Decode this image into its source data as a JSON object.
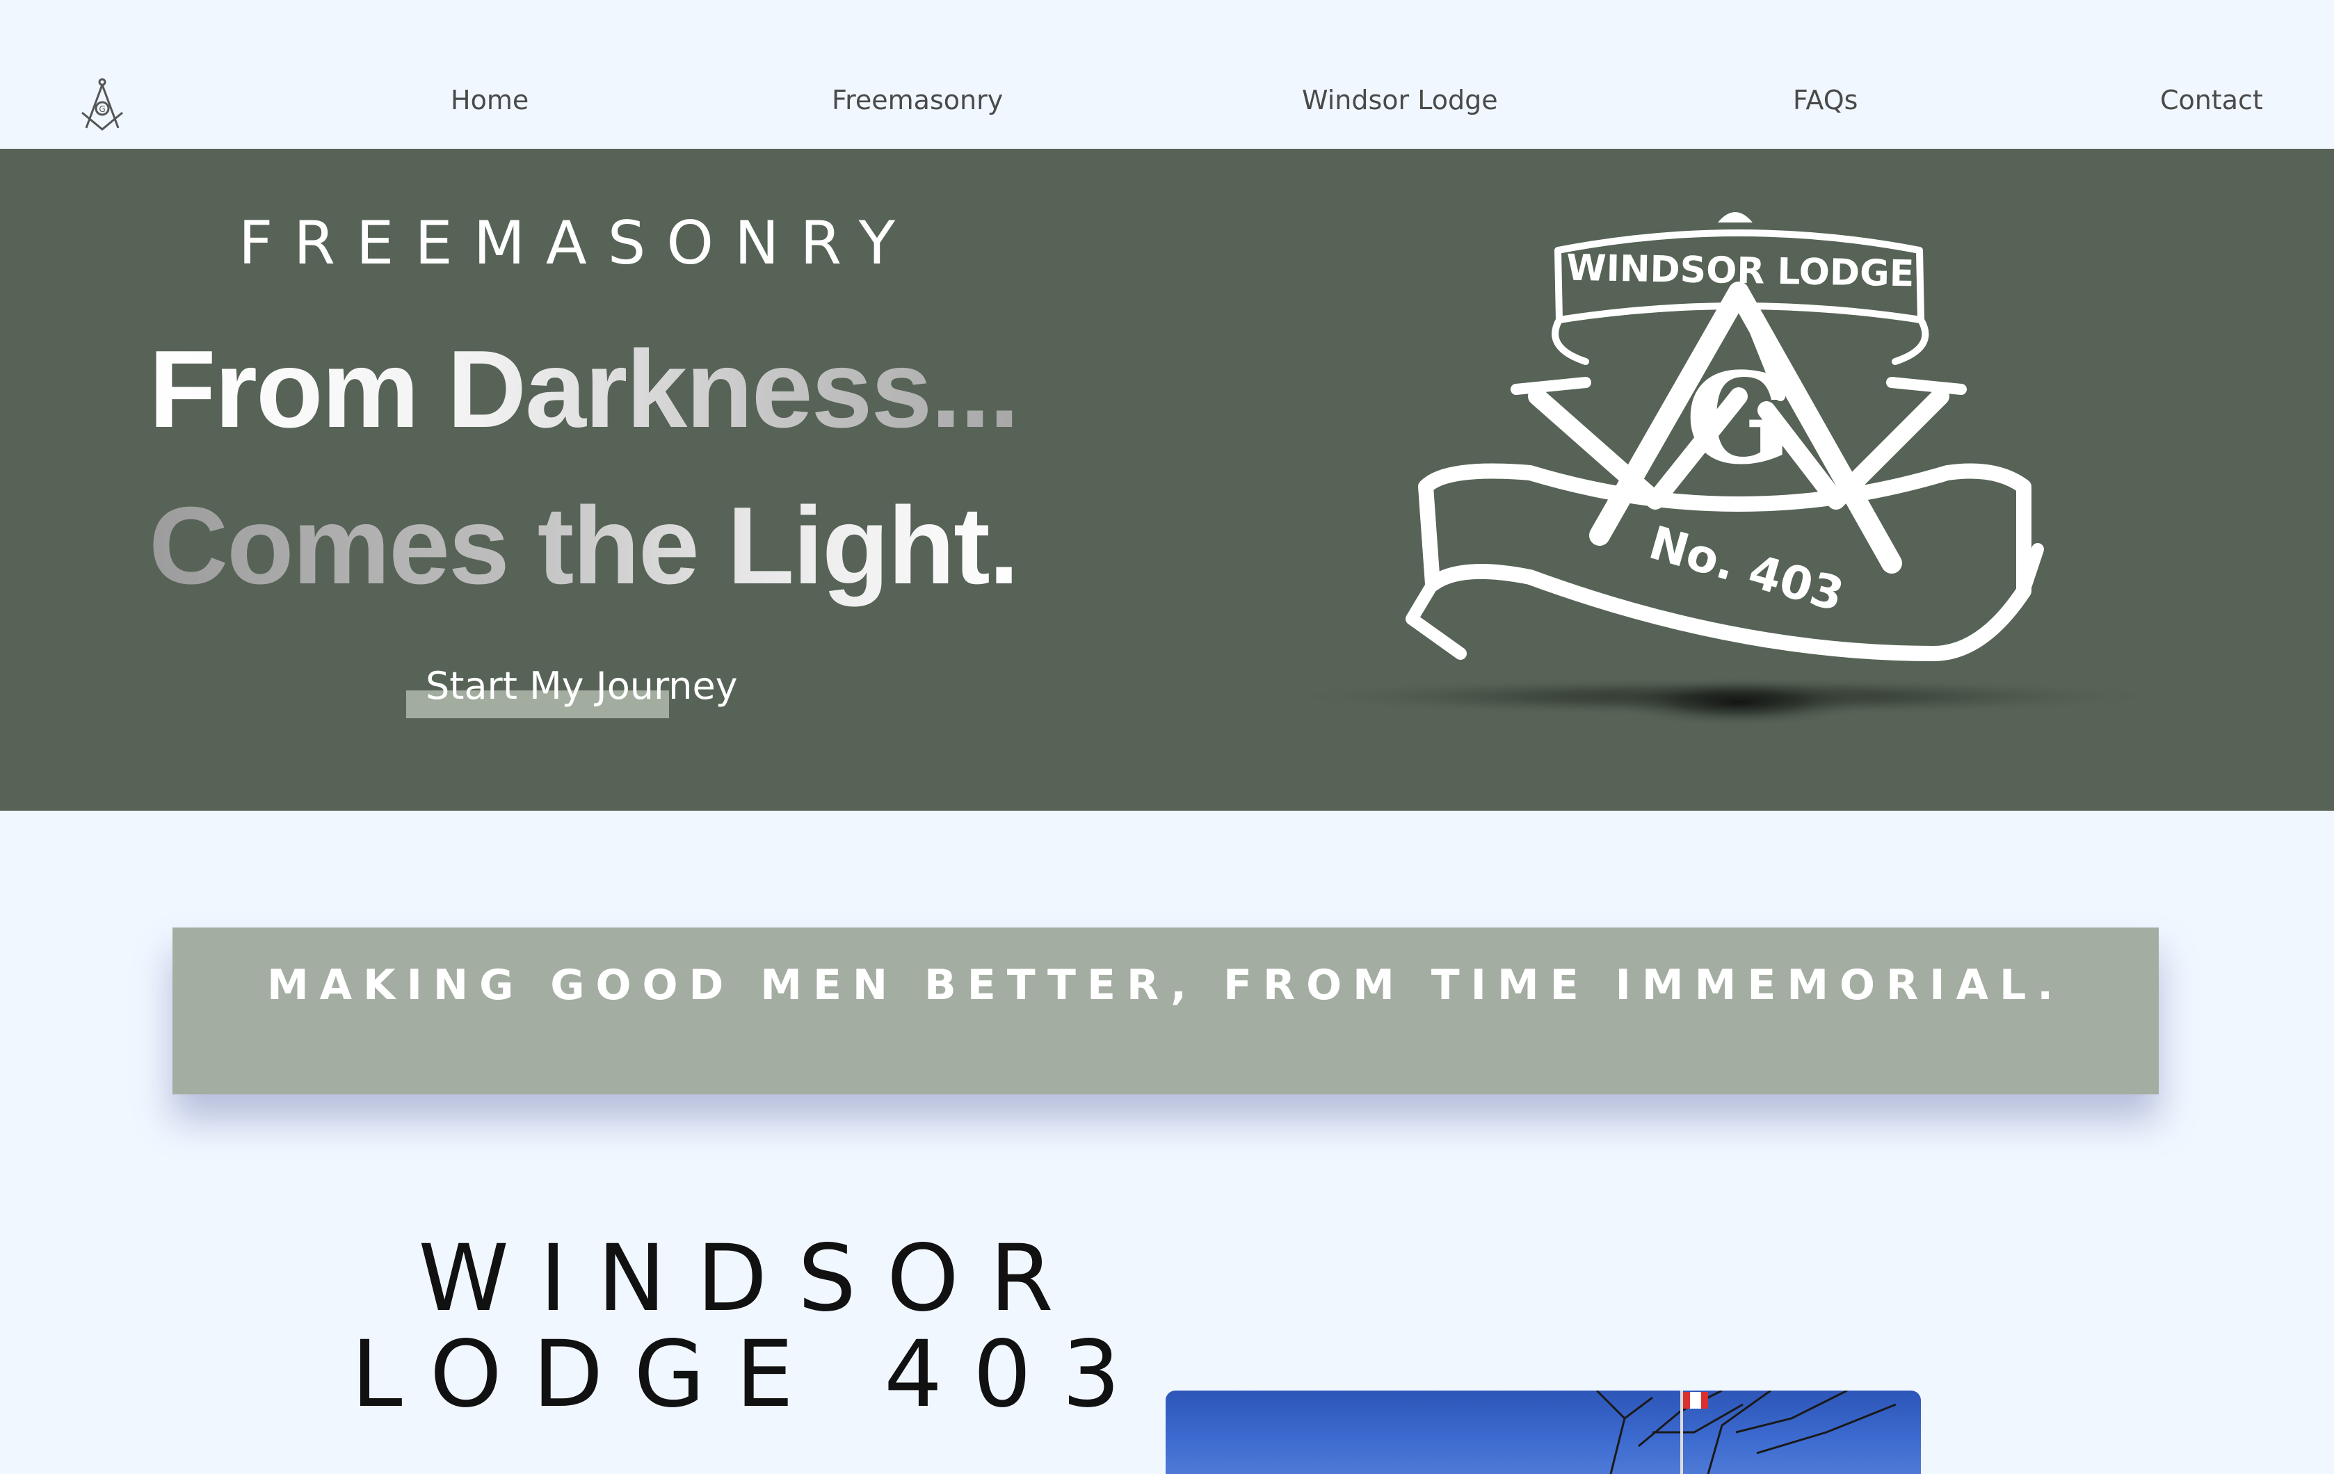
{
  "nav": {
    "logo_icon": "square-and-compass-icon",
    "items": [
      {
        "label": "Home"
      },
      {
        "label": "Freemasonry"
      },
      {
        "label": "Windsor Lodge"
      },
      {
        "label": "FAQs"
      },
      {
        "label": "Contact"
      }
    ]
  },
  "hero": {
    "kicker": "FREEMASONRY",
    "headline_line1": "From Darkness...",
    "headline_line2": "Comes the Light.",
    "cta_label": "Start My Journey",
    "emblem": {
      "top_text": "WINDSOR LODGE",
      "center_letter": "G",
      "banner_text": "No. 403"
    },
    "background_color": "#576356"
  },
  "tagline": {
    "text": "MAKING GOOD MEN BETTER, FROM TIME IMMEMORIAL."
  },
  "section": {
    "title_line1": "WINDSOR",
    "title_line2": "LODGE 403"
  }
}
